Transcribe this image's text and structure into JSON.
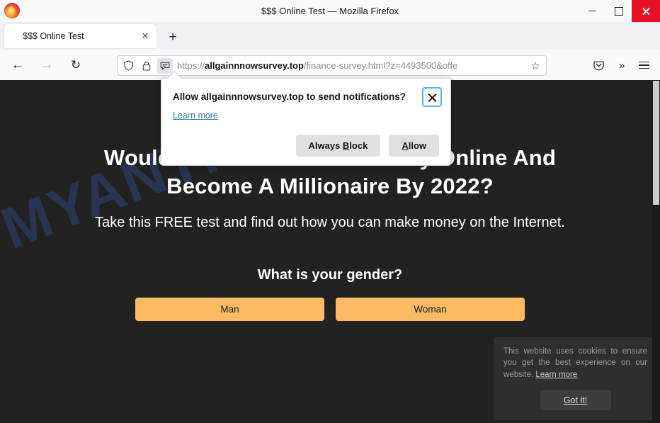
{
  "window": {
    "title": "$$$ Online Test — Mozilla Firefox",
    "minimize_label": "Minimize",
    "maximize_label": "Maximize",
    "close_label": "Close"
  },
  "tabs": {
    "items": [
      {
        "label": "$$$ Online Test",
        "close_glyph": "✕"
      }
    ],
    "new_tab_glyph": "+"
  },
  "toolbar": {
    "back_glyph": "←",
    "forward_glyph": "→",
    "reload_glyph": "↻",
    "shield_icon": "shield-icon",
    "lock_icon": "lock-icon",
    "notification_icon": "notification-permission-icon",
    "bookmark_glyph": "☆",
    "pocket_icon": "pocket-icon",
    "overflow_glyph": "»",
    "menu_icon": "hamburger-menu-icon"
  },
  "url": {
    "scheme": "https://",
    "host": "allgainnnowsurvey.top",
    "path": "/finance-survey.html?z=4493500&offe",
    "full": "https://allgainnnowsurvey.top/finance-survey.html?z=4493500&offe"
  },
  "doorhanger": {
    "title": "Allow allgainnnowsurvey.top to send notifications?",
    "learn_more": "Learn more",
    "always_block_prefix": "Always ",
    "always_block_accesskey": "B",
    "always_block_suffix": "lock",
    "allow_accesskey": "A",
    "allow_suffix": "llow",
    "close_label": "✕"
  },
  "page": {
    "watermark": "MYANTISPYWARE.COM",
    "headline": "Would You Like To Earn Money Online And Become A Millionaire By 2022?",
    "subhead": "Take this FREE test and find out how you can make money on the Internet.",
    "question": "What is your gender?",
    "answers": [
      {
        "label": "Man"
      },
      {
        "label": "Woman"
      }
    ],
    "background_color": "#222222",
    "answer_color": "#fbba61"
  },
  "cookie_banner": {
    "text": "This website uses cookies to ensure you get the best experience on our website. ",
    "learn_more": "Learn more",
    "button": "Got it!"
  }
}
